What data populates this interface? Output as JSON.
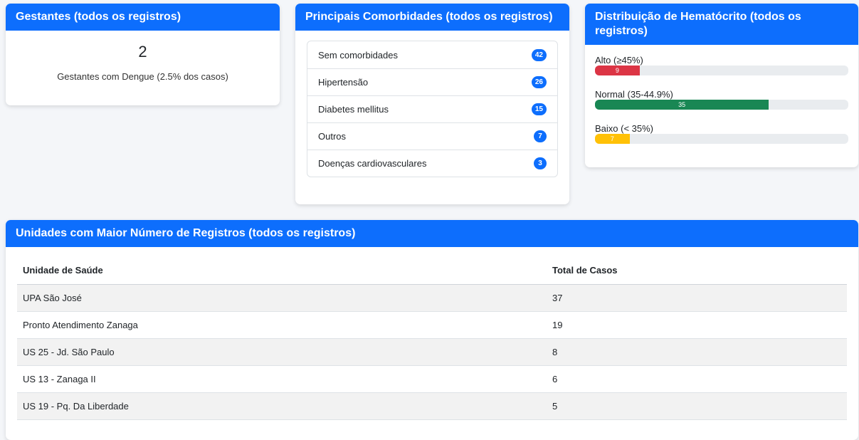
{
  "gestantes": {
    "title": "Gestantes (todos os registros)",
    "count": "2",
    "description": "Gestantes com Dengue (2.5% dos casos)"
  },
  "comorbidades": {
    "title": "Principais Comorbidades (todos os registros)",
    "items": [
      {
        "label": "Sem comorbidades",
        "count": "42"
      },
      {
        "label": "Hipertensão",
        "count": "26"
      },
      {
        "label": "Diabetes mellitus",
        "count": "15"
      },
      {
        "label": "Outros",
        "count": "7"
      },
      {
        "label": "Doenças cardiovasculares",
        "count": "3"
      }
    ]
  },
  "hematocrito": {
    "title": "Distribuição de Hematócrito (todos os registros)",
    "items": [
      {
        "label": "Alto (≥45%)",
        "value": "9",
        "percent": 17.6,
        "color": "#dc3545"
      },
      {
        "label": "Normal (35-44.9%)",
        "value": "35",
        "percent": 68.6,
        "color": "#198754"
      },
      {
        "label": "Baixo (< 35%)",
        "value": "7",
        "percent": 13.7,
        "color": "#ffc107"
      }
    ]
  },
  "unidades": {
    "title": "Unidades com Maior Número de Registros (todos os registros)",
    "columns": [
      "Unidade de Saúde",
      "Total de Casos"
    ],
    "rows": [
      [
        "UPA São José",
        "37"
      ],
      [
        "Pronto Atendimento Zanaga",
        "19"
      ],
      [
        "US 25 - Jd. São Paulo",
        "8"
      ],
      [
        "US 13 - Zanaga II",
        "6"
      ],
      [
        "US 19 - Pq. Da Liberdade",
        "5"
      ]
    ]
  },
  "colors": {
    "primary": "#0d6efd"
  }
}
